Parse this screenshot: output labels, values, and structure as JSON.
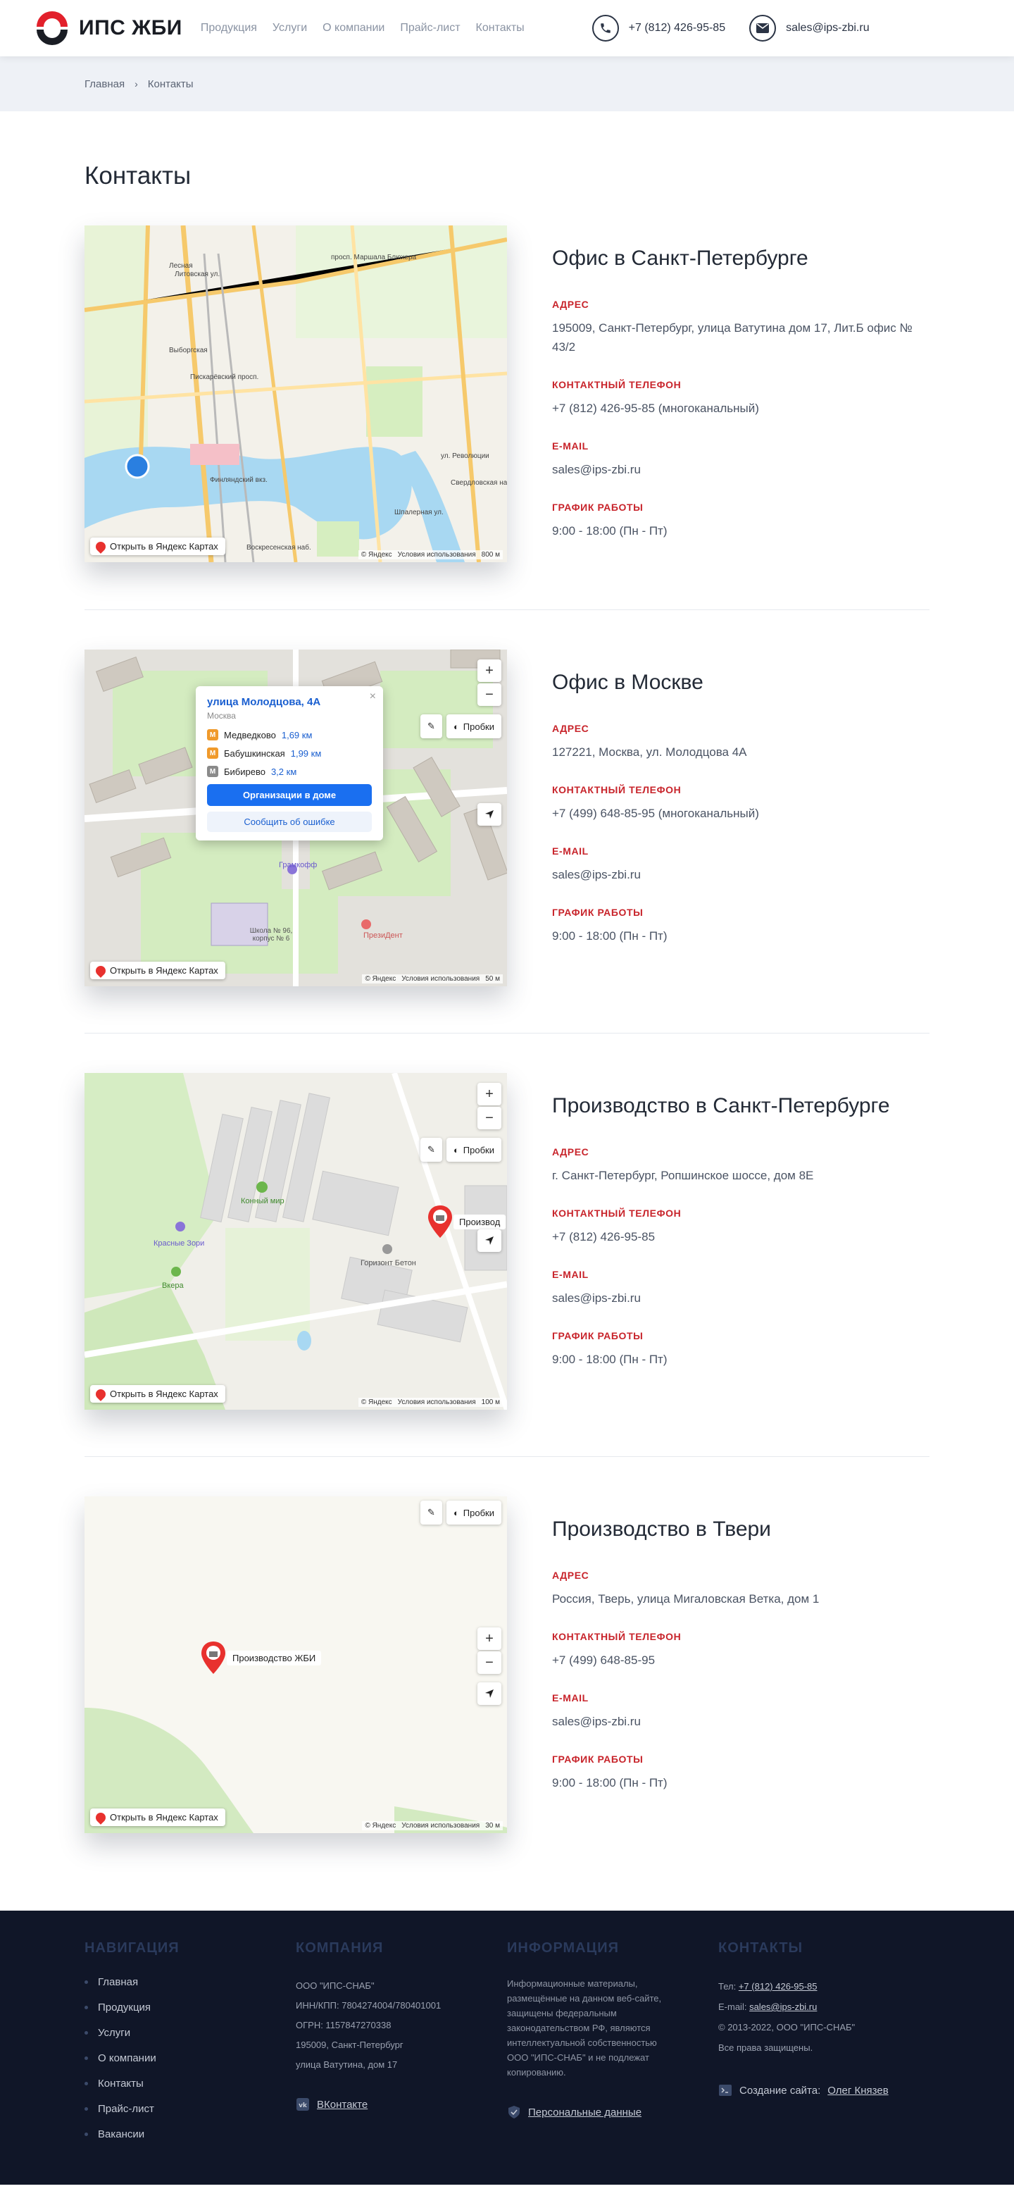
{
  "header": {
    "logo_text": "ИПС ЖБИ",
    "nav": [
      "Продукция",
      "Услуги",
      "О компании",
      "Прайс-лист",
      "Контакты"
    ],
    "phone": "+7 (812) 426-95-85",
    "email": "sales@ips-zbi.ru"
  },
  "breadcrumb": {
    "home": "Главная",
    "current": "Контакты"
  },
  "page": {
    "title": "Контакты"
  },
  "labels": {
    "address": "Адрес",
    "phone": "Контактный телефон",
    "email": "E-mail",
    "hours": "График работы"
  },
  "offices": [
    {
      "title": "Офис в Санкт-Петербурге",
      "address": "195009, Санкт-Петербург, улица Ватутина дом 17, Лит.Б офис № 43/2",
      "phone": "+7 (812) 426-95-85 (многоканальный)",
      "email": "sales@ips-zbi.ru",
      "hours": "9:00 - 18:00 (Пн - Пт)",
      "map": {
        "open_label": "Открыть в Яндекс Картах",
        "copyright": "© Яндекс",
        "terms": "Условия использования",
        "scale": "800 м",
        "streets": [
          "Лесная",
          "Выборгская",
          "Финляндский вкз.",
          "просп. Маршала Блюхера",
          "Литовская ул.",
          "Воскресенская наб.",
          "ул. Революции",
          "Пискарёвский просп.",
          "Шпалерная ул.",
          "Свердловская наб."
        ]
      }
    },
    {
      "title": "Офис в Москве",
      "address": "127221, Москва, ул. Молодцова 4А",
      "phone": "+7 (499) 648-85-95 (многоканальный)",
      "email": "sales@ips-zbi.ru",
      "hours": "9:00 - 18:00 (Пн - Пт)",
      "map": {
        "open_label": "Открыть в Яндекс Картах",
        "copyright": "© Яндекс",
        "terms": "Условия использования",
        "scale": "50 м",
        "traffic": "Пробки",
        "popup": {
          "title": "улица Молодцова, 4А",
          "city": "Москва",
          "metro": [
            {
              "name": "Медведково",
              "dist": "1,69 км"
            },
            {
              "name": "Бабушкинская",
              "dist": "1,99 км"
            },
            {
              "name": "Бибирево",
              "dist": "3,2 км"
            }
          ],
          "btn_orgs": "Организации в доме",
          "btn_report": "Сообщить об ошибке"
        },
        "places": [
          "Грамкофф",
          "ПрезиДент",
          "Школа № 96, корпус № 6"
        ]
      }
    },
    {
      "title": "Производство в Санкт-Петербурге",
      "address": "г. Санкт-Петербург, Ропшинское шоссе, дом 8Е",
      "phone": "+7 (812) 426-95-85",
      "email": "sales@ips-zbi.ru",
      "hours": "9:00 - 18:00 (Пн - Пт)",
      "map": {
        "open_label": "Открыть в Яндекс Картах",
        "copyright": "© Яндекс",
        "terms": "Условия использования",
        "scale": "100 м",
        "traffic": "Пробки",
        "placemark": "Производ",
        "places": [
          "Конный мир",
          "Красные Зори",
          "Вкера",
          "Горизонт Бетон"
        ]
      }
    },
    {
      "title": "Производство в Твери",
      "address": "Россия, Тверь, улица Мигаловская Ветка, дом 1",
      "phone": "+7 (499) 648-85-95",
      "email": "sales@ips-zbi.ru",
      "hours": "9:00 - 18:00 (Пн - Пт)",
      "map": {
        "open_label": "Открыть в Яндекс Картах",
        "copyright": "© Яндекс",
        "terms": "Условия использования",
        "scale": "30 м",
        "traffic": "Пробки",
        "placemark": "Производство ЖБИ"
      }
    }
  ],
  "footer": {
    "nav_title": "Навигация",
    "nav": [
      "Главная",
      "Продукция",
      "Услуги",
      "О компании",
      "Контакты",
      "Прайс-лист",
      "Вакансии"
    ],
    "company_title": "Компания",
    "company_lines": [
      "ООО \"ИПС-СНАБ\"",
      "ИНН/КПП: 7804274004/780401001",
      "ОГРН: 1157847270338",
      "195009, Санкт-Петербург",
      "улица Ватутина, дом 17"
    ],
    "vk": "ВКонтакте",
    "info_title": "Информация",
    "info_text": "Информационные материалы, размещённые на данном веб-сайте, защищены федеральным законодательством РФ, являются интеллектуальной собственностью ООО \"ИПС-СНАБ\" и не подлежат копированию.",
    "personal": "Персональные данные",
    "contacts_title": "Контакты",
    "tel_label": "Тел:",
    "tel": "+7 (812) 426-95-85",
    "email_label": "E-mail:",
    "email": "sales@ips-zbi.ru",
    "copyright": "© 2013-2022, ООО \"ИПС-СНАБ\"",
    "rights": "Все права защищены.",
    "created_label": "Создание сайта:",
    "created_by": "Олег Князев"
  },
  "colors": {
    "accent": "#c8242b",
    "footer_bg": "#101628",
    "breadcrumb_bg": "#eef1f6"
  }
}
